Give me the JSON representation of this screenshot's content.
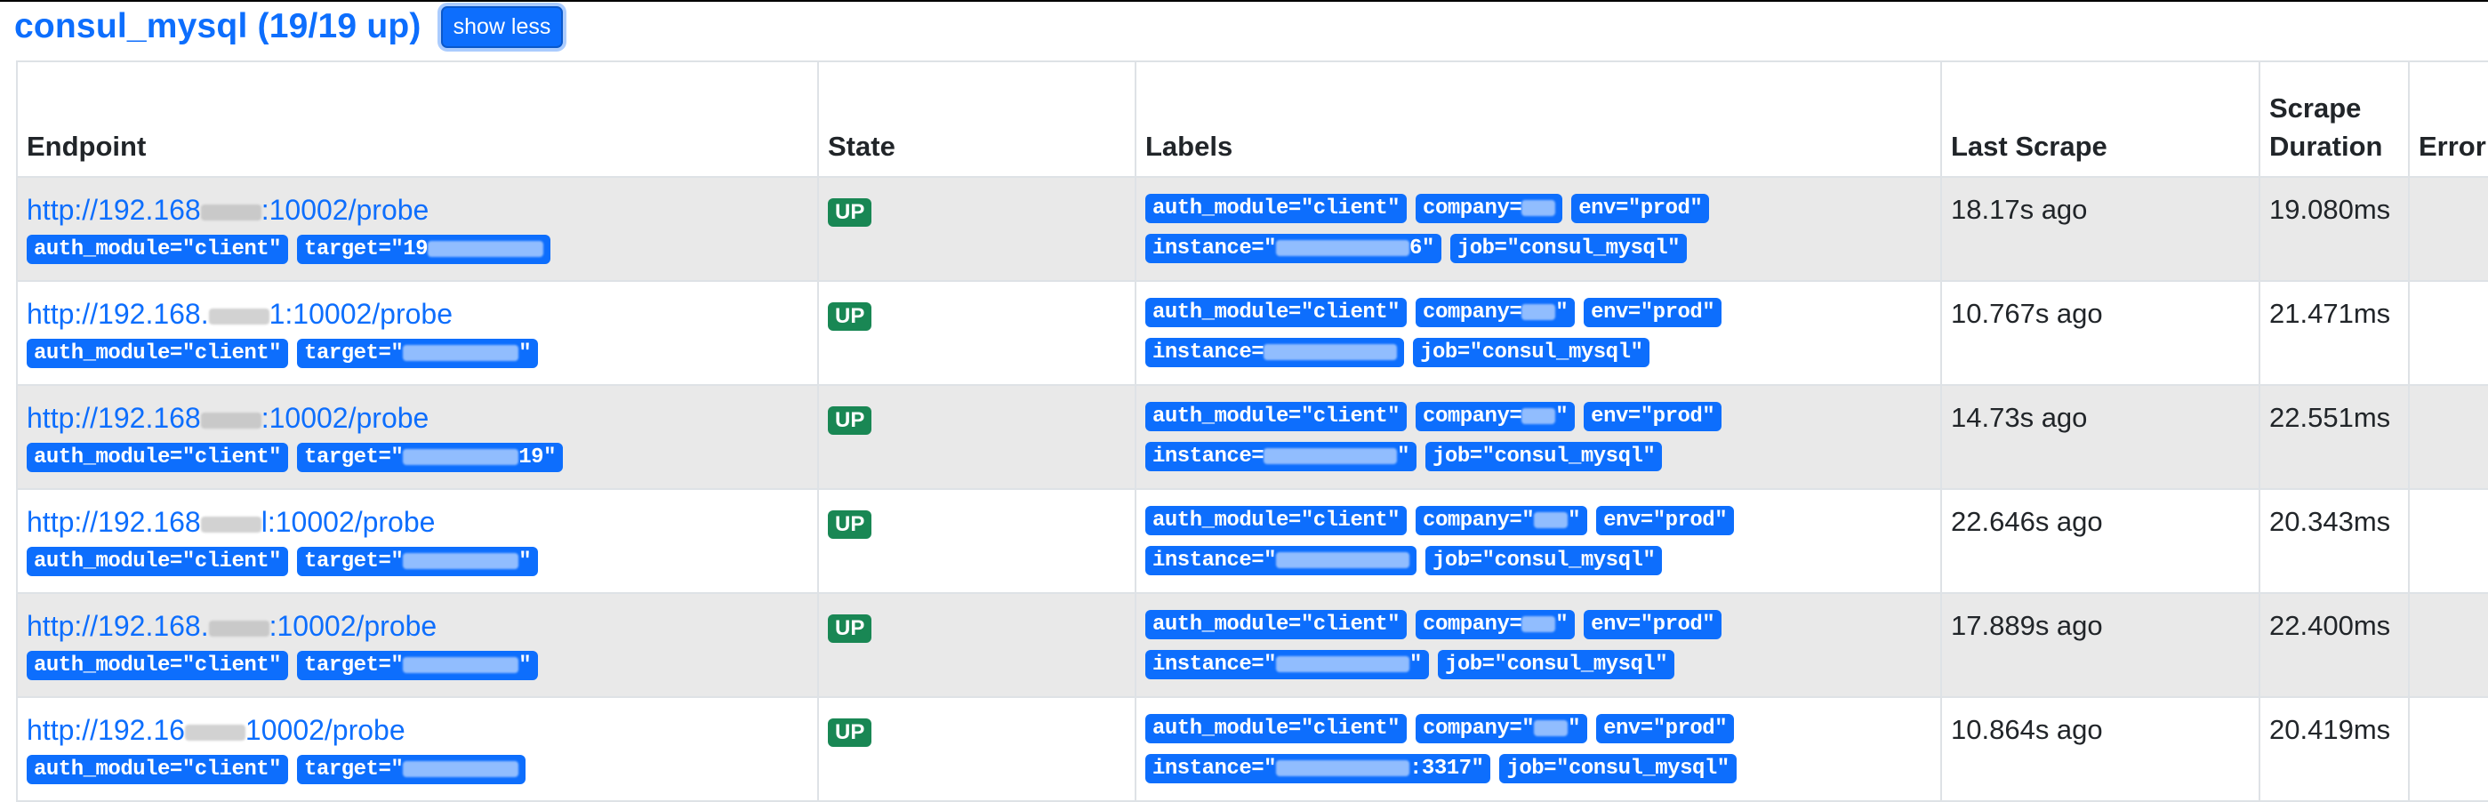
{
  "job": {
    "title": "consul_mysql (19/19 up)",
    "toggle_label": "show less"
  },
  "table": {
    "headers": {
      "endpoint": "Endpoint",
      "state": "State",
      "labels": "Labels",
      "last_scrape": "Last Scrape",
      "scrape_duration_line1": "Scrape",
      "scrape_duration_line2": "Duration",
      "error": "Error"
    },
    "rows": [
      {
        "endpoint_a": "http://192.168",
        "endpoint_b": ":10002/probe",
        "ep_auth": "auth_module=\"client\"",
        "ep_target_a": "target=\"19",
        "ep_target_b": "",
        "state": "UP",
        "l_auth": "auth_module=\"client\"",
        "l_company_a": "company=",
        "l_company_b": "",
        "l_env": "env=\"prod\"",
        "l_instance_a": "instance=\"",
        "l_instance_b": "6\"",
        "l_job": "job=\"consul_mysql\"",
        "last_scrape": "18.17s ago",
        "duration": "19.080ms"
      },
      {
        "endpoint_a": "http://192.168.",
        "endpoint_b": "1:10002/probe",
        "ep_auth": "auth_module=\"client\"",
        "ep_target_a": "target=\"",
        "ep_target_b": "\"",
        "state": "UP",
        "l_auth": "auth_module=\"client\"",
        "l_company_a": "company=",
        "l_company_b": "\"",
        "l_env": "env=\"prod\"",
        "l_instance_a": "instance=",
        "l_instance_b": "",
        "l_job": "job=\"consul_mysql\"",
        "last_scrape": "10.767s ago",
        "duration": "21.471ms"
      },
      {
        "endpoint_a": "http://192.168",
        "endpoint_b": ":10002/probe",
        "ep_auth": "auth_module=\"client\"",
        "ep_target_a": "target=\"",
        "ep_target_b": "19\"",
        "state": "UP",
        "l_auth": "auth_module=\"client\"",
        "l_company_a": "company=",
        "l_company_b": "\"",
        "l_env": "env=\"prod\"",
        "l_instance_a": "instance=",
        "l_instance_b": "\"",
        "l_job": "job=\"consul_mysql\"",
        "last_scrape": "14.73s ago",
        "duration": "22.551ms"
      },
      {
        "endpoint_a": "http://192.168",
        "endpoint_b": "l:10002/probe",
        "ep_auth": "auth_module=\"client\"",
        "ep_target_a": "target=\"",
        "ep_target_b": "\"",
        "state": "UP",
        "l_auth": "auth_module=\"client\"",
        "l_company_a": "company=\"",
        "l_company_b": "\"",
        "l_env": "env=\"prod\"",
        "l_instance_a": "instance=\"",
        "l_instance_b": "",
        "l_job": "job=\"consul_mysql\"",
        "last_scrape": "22.646s ago",
        "duration": "20.343ms"
      },
      {
        "endpoint_a": "http://192.168.",
        "endpoint_b": ":10002/probe",
        "ep_auth": "auth_module=\"client\"",
        "ep_target_a": "target=\"",
        "ep_target_b": "\"",
        "state": "UP",
        "l_auth": "auth_module=\"client\"",
        "l_company_a": "company=",
        "l_company_b": "\"",
        "l_env": "env=\"prod\"",
        "l_instance_a": "instance=\"",
        "l_instance_b": "\"",
        "l_job": "job=\"consul_mysql\"",
        "last_scrape": "17.889s ago",
        "duration": "22.400ms"
      },
      {
        "endpoint_a": "http://192.16",
        "endpoint_b": "10002/probe",
        "ep_auth": "auth_module=\"client\"",
        "ep_target_a": "target=\"",
        "ep_target_b": "",
        "state": "UP",
        "l_auth": "auth_module=\"client\"",
        "l_company_a": "company=\"",
        "l_company_b": "\"",
        "l_env": "env=\"prod\"",
        "l_instance_a": "instance=\"",
        "l_instance_b": ":3317\"",
        "l_job": "job=\"consul_mysql\"",
        "last_scrape": "10.864s ago",
        "duration": "20.419ms"
      }
    ]
  }
}
